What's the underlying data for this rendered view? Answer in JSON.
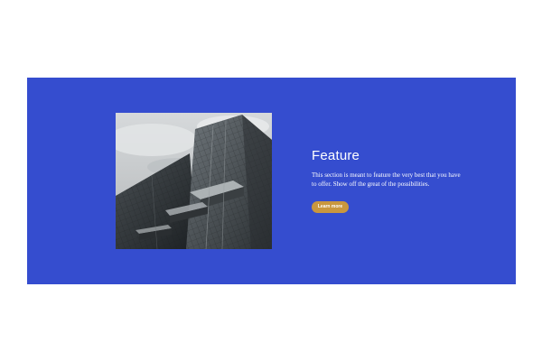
{
  "colors": {
    "page_background": "#ffffff",
    "section_background": "#354dcf",
    "button_background": "#c9973e",
    "text": "#ffffff"
  },
  "feature": {
    "title": "Feature",
    "description": "This section is meant to feature the very best that you have to offer. Show off the great of the possibilities.",
    "button_label": "Learn more",
    "image_subject": "skyscraper-building-photo"
  }
}
